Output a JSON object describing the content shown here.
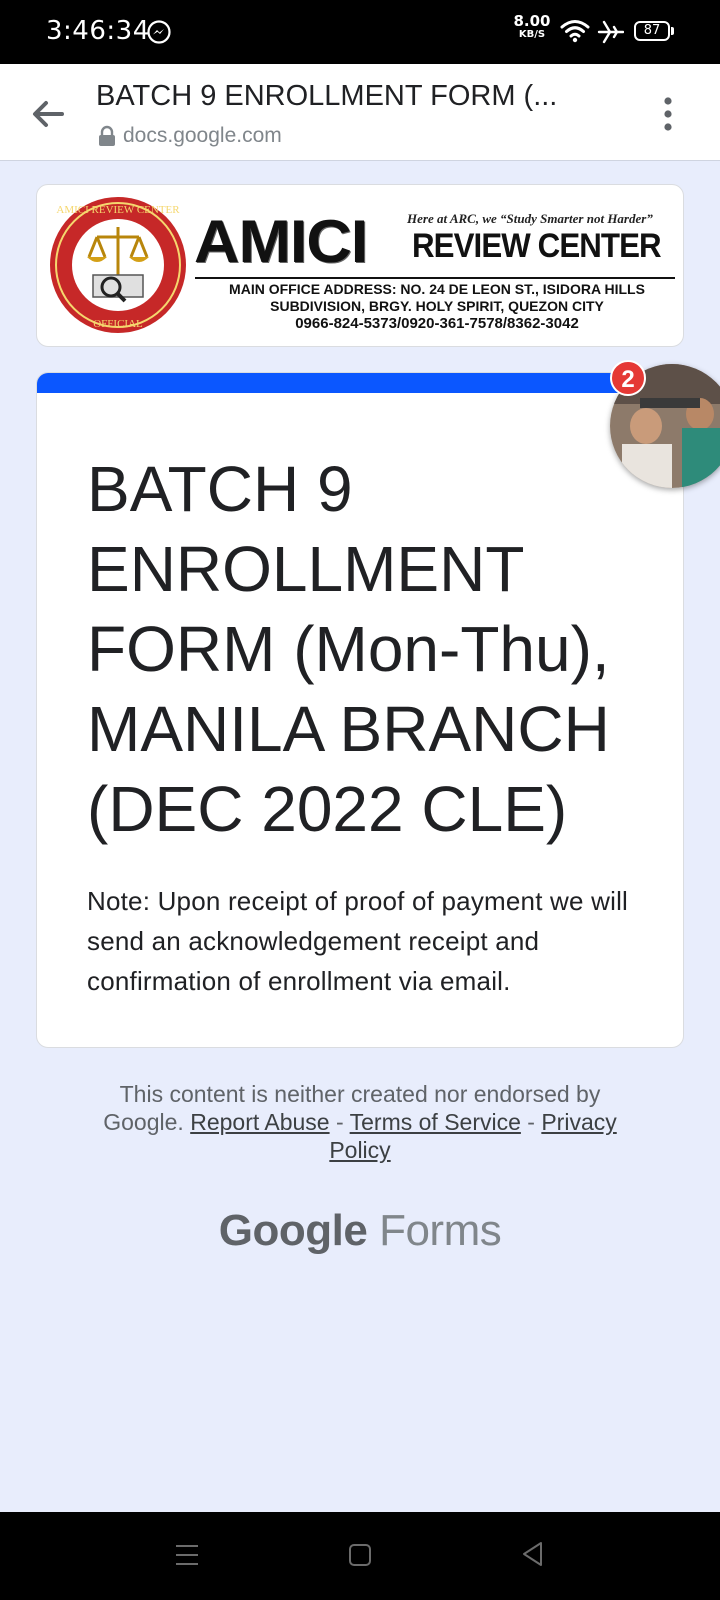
{
  "status_bar": {
    "time": "3:46:34",
    "net_speed_value": "8.00",
    "net_speed_unit": "KB/S",
    "battery": "87",
    "icons": [
      "messenger-icon",
      "wifi-icon",
      "airplane-mode-icon",
      "battery-icon"
    ]
  },
  "browser": {
    "page_title": "BATCH 9 ENROLLMENT FORM (...",
    "url": "docs.google.com",
    "icons": [
      "back-arrow-icon",
      "lock-icon",
      "overflow-menu-icon"
    ]
  },
  "banner": {
    "seal_text": "AMICI REVIEW CENTER OFFICIAL",
    "logo_main": "AMICI",
    "logo_sub": "REVIEW CENTER",
    "tagline": "Here at ARC, we “Study Smarter not Harder”",
    "address_line1": "MAIN OFFICE ADDRESS: NO. 24 DE LEON ST., ISIDORA HILLS",
    "address_line2": "SUBDIVISION, BRGY. HOLY SPIRIT, QUEZON CITY",
    "phones": "0966-824-5373/0920-361-7578/8362-3042"
  },
  "form": {
    "title": "BATCH 9 ENROLLMENT FORM (Mon-Thu), MANILA BRANCH (DEC 2022 CLE)",
    "note": "Note: Upon receipt of proof of payment we will send an acknowledgement receipt and confirmation of enrollment via email.",
    "accent_color": "#0b57ff"
  },
  "chat_head": {
    "badge_count": "2"
  },
  "footer": {
    "disclaimer_prefix": "This content is neither created nor endorsed by Google.",
    "report_abuse": "Report Abuse",
    "separator": "-",
    "terms": "Terms of Service",
    "privacy": "Privacy Policy",
    "brand_google": "Google",
    "brand_forms": "Forms"
  },
  "colors": {
    "page_background": "#e8edfc",
    "badge": "#e53935"
  }
}
